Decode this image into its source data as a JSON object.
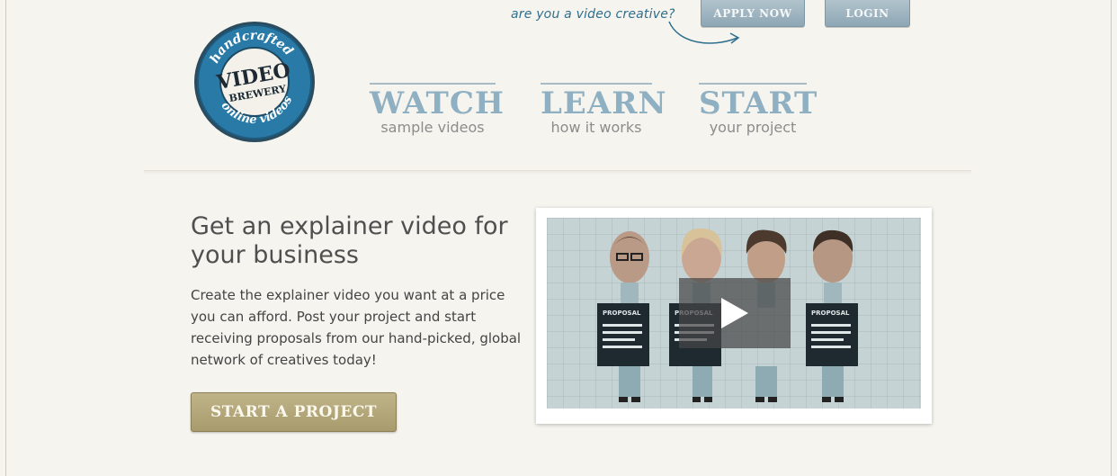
{
  "header": {
    "creative_prompt": "are you a video creative?",
    "apply_label": "APPLY NOW",
    "login_label": "LOGIN"
  },
  "logo": {
    "arc_top": "handcrafted",
    "word_1": "VIDEO",
    "word_2": "BREWERY",
    "arc_bottom": "online videos"
  },
  "nav": [
    {
      "title": "WATCH",
      "subtitle": "sample videos"
    },
    {
      "title": "LEARN",
      "subtitle": "how it works"
    },
    {
      "title": "START",
      "subtitle": "your project"
    }
  ],
  "hero": {
    "headline": "Get an explainer video for your business",
    "body": "Create the explainer video you want at a price you can afford. Post your project and start receiving proposals from our hand-picked, global network of creatives today!",
    "cta_label": "START A PROJECT"
  },
  "video": {
    "sign_label": "PROPOSAL",
    "play_icon": "play-icon"
  },
  "colors": {
    "background": "#f6f4ee",
    "nav_blue": "#8fb0c2",
    "logo_blue": "#2a7aa8",
    "cta_gold": "#b2a67a",
    "top_button": "#9db3bf"
  }
}
